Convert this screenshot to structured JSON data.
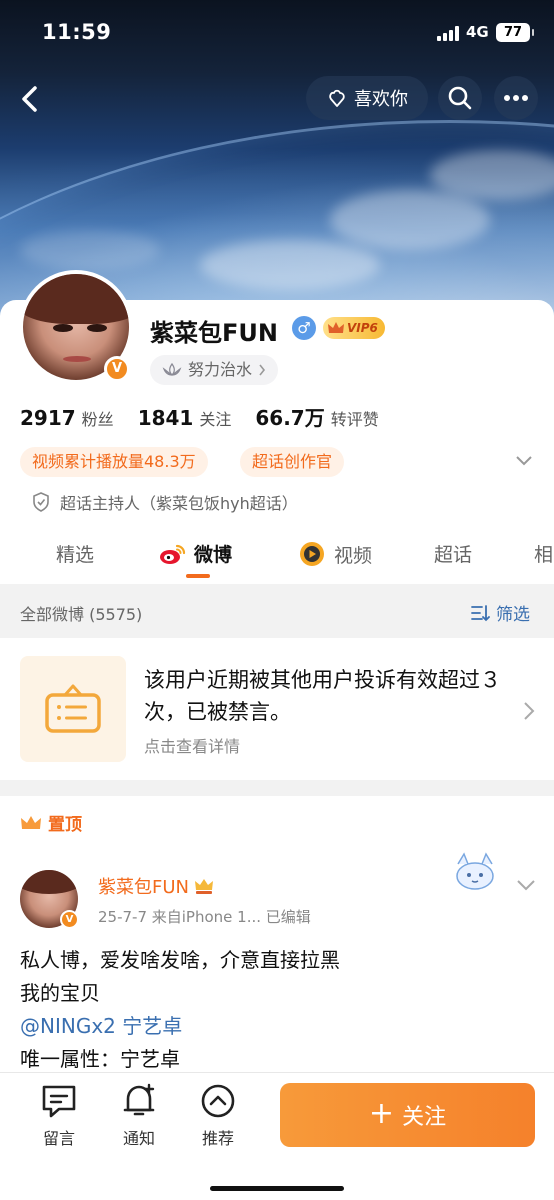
{
  "status_bar": {
    "time": "11:59",
    "network": "4G",
    "battery": "77"
  },
  "header": {
    "like_button": "喜欢你",
    "icons": [
      "back-icon",
      "search-icon",
      "more-icon"
    ]
  },
  "profile": {
    "username": "紫菜包FUN",
    "gender": "♂",
    "vip_level": "VIP6",
    "tag": "努力治水",
    "verified_badge": "V",
    "stats": [
      {
        "num": "2917",
        "label": "粉丝"
      },
      {
        "num": "1841",
        "label": "关注"
      },
      {
        "num": "66.7万",
        "label": "转评赞"
      }
    ],
    "chips": [
      "视频累计播放量48.3万",
      "超话创作官"
    ],
    "host_line": "超话主持人（紫菜包饭hyh超话）"
  },
  "tabs": [
    {
      "label": "精选"
    },
    {
      "label": "微博"
    },
    {
      "label": "视频"
    },
    {
      "label": "超话"
    },
    {
      "label": "相"
    }
  ],
  "filter_bar": {
    "all_label": "全部微博 (5575)",
    "filter_label": "筛选"
  },
  "notice": {
    "title": "该用户近期被其他用户投诉有效超过３次，已被禁言。",
    "subtitle": "点击查看详情"
  },
  "post": {
    "pin_label": "置顶",
    "author": "紫菜包FUN",
    "meta": "25-7-7   来自iPhone 1...   已编辑",
    "lines": [
      "私人博，爱发啥发啥，介意直接拉黑",
      "我的宝贝"
    ],
    "mention": "@NINGx2 宁艺卓",
    "last_line": "唯一属性：宁艺卓"
  },
  "bottom_bar": {
    "items": [
      {
        "label": "留言",
        "icon": "comment-icon"
      },
      {
        "label": "通知",
        "icon": "bell-icon"
      },
      {
        "label": "推荐",
        "icon": "chevron-up-circle-icon"
      }
    ],
    "follow_button": "关注",
    "follow_plus": "+"
  },
  "colors": {
    "accent": "#f26b1d",
    "link": "#3a6fb0",
    "follow_gradient_start": "#f79a3a",
    "follow_gradient_end": "#f5812b"
  }
}
